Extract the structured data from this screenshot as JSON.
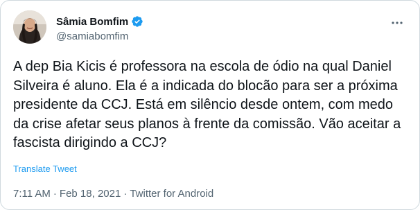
{
  "author": {
    "display_name": "Sâmia Bomfim",
    "handle": "@samiabomfim",
    "verified_icon": "verified-badge-icon",
    "avatar_icon": "avatar-photo"
  },
  "tweet": {
    "text": "A dep Bia Kicis é professora na escola de ódio na qual Daniel Silveira é aluno. Ela é a indicada do blocão para ser a próxima presidente da CCJ. Está em silêncio desde ontem, com medo da crise afetar seus planos à frente da comissão. Vão aceitar a fascista dirigindo a CCJ?",
    "translate_label": "Translate Tweet",
    "time": "7:11 AM",
    "separator": "·",
    "date": "Feb 18, 2021",
    "source": "Twitter for Android"
  },
  "menu": {
    "more_icon": "more-options-icon"
  },
  "colors": {
    "accent": "#1d9bf0",
    "text": "#0f1419",
    "secondary": "#536471",
    "border": "#cfd9de"
  }
}
